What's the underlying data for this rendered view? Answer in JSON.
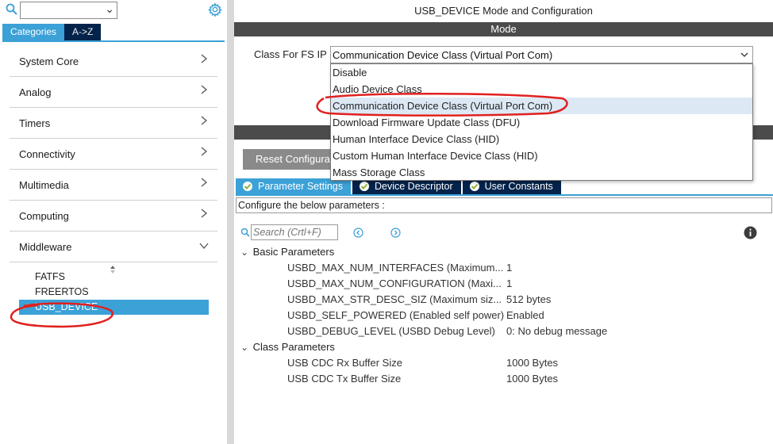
{
  "left": {
    "filter_value": "",
    "tabs": [
      {
        "label": "Categories"
      },
      {
        "label": "A->Z"
      }
    ],
    "categories": [
      {
        "label": "System Core"
      },
      {
        "label": "Analog"
      },
      {
        "label": "Timers"
      },
      {
        "label": "Connectivity"
      },
      {
        "label": "Multimedia"
      },
      {
        "label": "Computing"
      },
      {
        "label": "Middleware"
      }
    ],
    "middleware_items": [
      {
        "label": "FATFS"
      },
      {
        "label": "FREERTOS"
      },
      {
        "label": "USB_DEVICE"
      }
    ]
  },
  "right": {
    "title": "USB_DEVICE Mode and Configuration",
    "mode_header": "Mode",
    "class_label": "Class For FS IP",
    "class_selected": "Communication Device Class (Virtual Port Com)",
    "dropdown_options": [
      {
        "label": "Disable"
      },
      {
        "label": "Audio Device Class"
      },
      {
        "label": "Communication Device Class (Virtual Port Com)"
      },
      {
        "label": "Download Firmware Update Class (DFU)"
      },
      {
        "label": "Human Interface Device Class (HID)"
      },
      {
        "label": "Custom Human Interface Device Class (HID)"
      },
      {
        "label": "Mass Storage Class"
      }
    ],
    "reset_label": "Reset Configuration",
    "param_tabs": [
      {
        "label": "Parameter Settings"
      },
      {
        "label": "Device Descriptor"
      },
      {
        "label": "User Constants"
      }
    ],
    "configure_text": "Configure the below parameters :",
    "search_placeholder": "Search (Crtl+F)",
    "groups": [
      {
        "name": "Basic Parameters",
        "params": [
          {
            "name": "USBD_MAX_NUM_INTERFACES (Maximum...",
            "value": "1"
          },
          {
            "name": "USBD_MAX_NUM_CONFIGURATION (Maxi...",
            "value": "1"
          },
          {
            "name": "USBD_MAX_STR_DESC_SIZ (Maximum siz...",
            "value": "512 bytes"
          },
          {
            "name": "USBD_SELF_POWERED (Enabled self power)",
            "value": "Enabled"
          },
          {
            "name": "USBD_DEBUG_LEVEL (USBD Debug Level)",
            "value": "0: No debug message"
          }
        ]
      },
      {
        "name": "Class Parameters",
        "params": [
          {
            "name": "USB CDC Rx Buffer Size",
            "value": "1000 Bytes"
          },
          {
            "name": "USB CDC Tx Buffer Size",
            "value": "1000 Bytes"
          }
        ]
      }
    ]
  },
  "colors": {
    "accent": "#3ba1d7",
    "dark_navy": "#03234b",
    "bar_gray": "#4b4b4b",
    "annotation_red": "#e0201f"
  }
}
